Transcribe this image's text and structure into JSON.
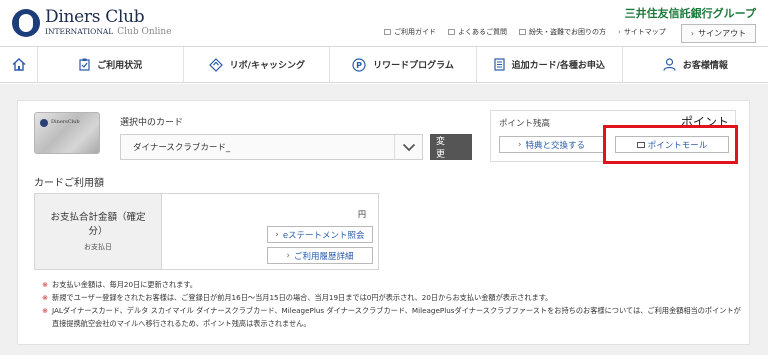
{
  "header": {
    "logo_name": "Diners Club",
    "logo_sub": "INTERNATIONAL",
    "logo_sub2": "Club Online",
    "brand_group": "三井住友信託銀行グループ",
    "util_links": [
      "ご利用ガイド",
      "よくあるご質問",
      "紛失・盗難でお困りの方",
      "サイトマップ"
    ],
    "signout_label": "サインアウト"
  },
  "nav": {
    "items": [
      "ご利用状況",
      "リボ/キャッシング",
      "リワードプログラム",
      "追加カード/各種お申込",
      "お客様情報"
    ]
  },
  "card_section": {
    "selected_label": "選択中のカード",
    "selected_card": "ダイナースクラブカード_",
    "change_label": "変 更",
    "thumb_brand": "DinersClub"
  },
  "points": {
    "title": "ポイント残高",
    "unit": "ポイント",
    "exchange_label": "特典と交換する",
    "mall_label": "ポイントモール"
  },
  "usage": {
    "title": "カードご利用額",
    "head_title": "お支払合計金額（確定分）",
    "head_sub": "お支払日",
    "yen": "円",
    "estatement_label": "eステートメント照会",
    "history_label": "ご利用履歴詳細"
  },
  "notes": [
    "お支払い金額は、毎月20日に更新されます。",
    "新規でユーザー登録をされたお客様は、ご登録日が前月16日～当月15日の場合、当月19日までは0円が表示され、20日からお支払い金額が表示されます。",
    "JALダイナースカード、デルタ スカイマイル ダイナースクラブカード、MileagePlus ダイナースクラブカード、MileagePlusダイナースクラブファーストをお持ちのお客様については、ご利用金額相当のポイントが直接提携航空会社のマイルへ移行されるため、ポイント残高は表示されません。"
  ],
  "note_mark": "※",
  "colors": {
    "brand_green": "#1a7a3a",
    "highlight_red": "#e0141e",
    "link_blue": "#2a5ca8",
    "logo_navy": "#1d3d7a"
  }
}
